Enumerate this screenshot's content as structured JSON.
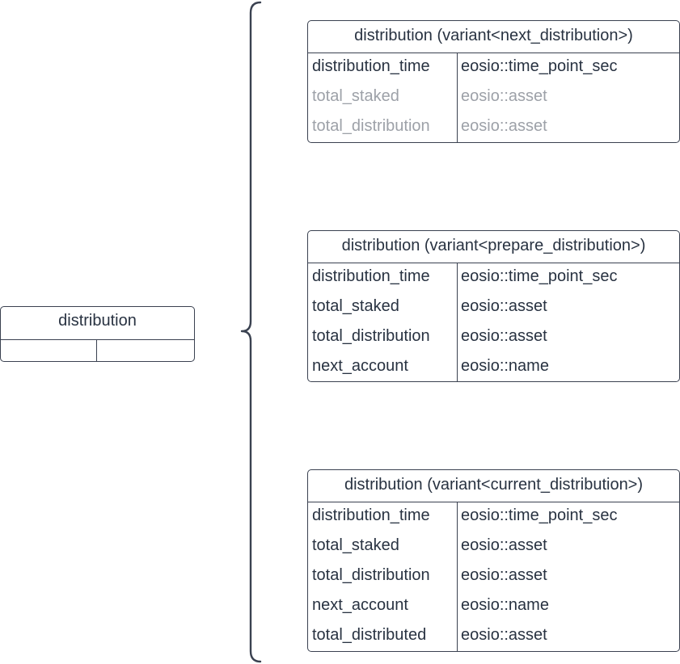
{
  "source_entity": {
    "title": "distribution"
  },
  "variants": [
    {
      "title": "distribution (variant<next_distribution>)",
      "fields": [
        {
          "name": "distribution_time",
          "type": "eosio::time_point_sec",
          "muted": false
        },
        {
          "name": "total_staked",
          "type": "eosio::asset",
          "muted": true
        },
        {
          "name": "total_distribution",
          "type": "eosio::asset",
          "muted": true
        }
      ]
    },
    {
      "title": "distribution (variant<prepare_distribution>)",
      "fields": [
        {
          "name": "distribution_time",
          "type": "eosio::time_point_sec",
          "muted": false
        },
        {
          "name": "total_staked",
          "type": "eosio::asset",
          "muted": false
        },
        {
          "name": "total_distribution",
          "type": "eosio::asset",
          "muted": false
        },
        {
          "name": "next_account",
          "type": "eosio::name",
          "muted": false
        }
      ]
    },
    {
      "title": "distribution (variant<current_distribution>)",
      "fields": [
        {
          "name": "distribution_time",
          "type": "eosio::time_point_sec",
          "muted": false
        },
        {
          "name": "total_staked",
          "type": "eosio::asset",
          "muted": false
        },
        {
          "name": "total_distribution",
          "type": "eosio::asset",
          "muted": false
        },
        {
          "name": "next_account",
          "type": "eosio::name",
          "muted": false
        },
        {
          "name": "total_distributed",
          "type": "eosio::asset",
          "muted": false
        }
      ]
    }
  ]
}
